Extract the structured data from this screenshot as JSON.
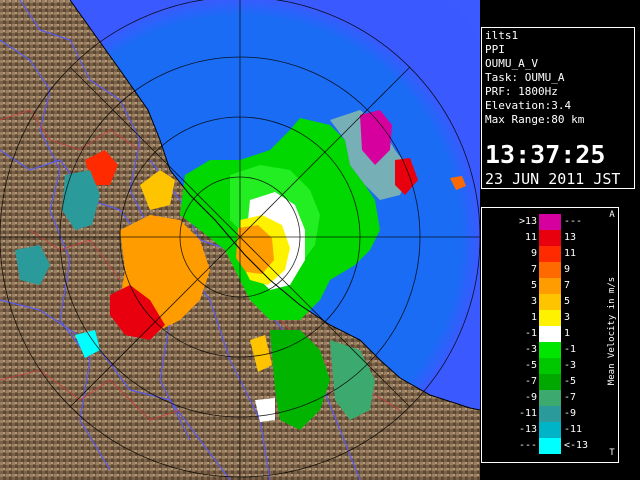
{
  "radar_info": {
    "station": "ilts1",
    "mode": "PPI",
    "product": "OUMU_A_V",
    "task": "Task: OUMU_A",
    "prf": "PRF: 1800Hz",
    "elevation": "Elevation:3.4",
    "max_range": "Max Range:80 km",
    "time": "13:37:25",
    "date": "23 JUN 2011 JST"
  },
  "legend": {
    "title": "Mean Velocity in m/s",
    "top_letter": "A",
    "bottom_letter": "T",
    "bins": [
      {
        "lo": ">13",
        "hi": "---",
        "color": "#d6009e"
      },
      {
        "lo": "11",
        "hi": "13",
        "color": "#e8000e"
      },
      {
        "lo": "9",
        "hi": "11",
        "color": "#ff2a00"
      },
      {
        "lo": "7",
        "hi": "9",
        "color": "#ff6a00"
      },
      {
        "lo": "5",
        "hi": "7",
        "color": "#ff9c00"
      },
      {
        "lo": "3",
        "hi": "5",
        "color": "#ffc400"
      },
      {
        "lo": "1",
        "hi": "3",
        "color": "#fff200"
      },
      {
        "lo": "-1",
        "hi": "1",
        "color": "#ffffff"
      },
      {
        "lo": "-3",
        "hi": "-1",
        "color": "#00e600"
      },
      {
        "lo": "-5",
        "hi": "-3",
        "color": "#00c800"
      },
      {
        "lo": "-7",
        "hi": "-5",
        "color": "#00a800"
      },
      {
        "lo": "-9",
        "hi": "-7",
        "color": "#3caa6e"
      },
      {
        "lo": "-11",
        "hi": "-9",
        "color": "#2a9a9a"
      },
      {
        "lo": "-13",
        "hi": "-11",
        "color": "#00b4c8"
      },
      {
        "lo": "---",
        "hi": "<-13",
        "color": "#00ffff"
      }
    ]
  },
  "colors": {
    "sea": "#0a78f0",
    "sea_edge": "#3c5aff",
    "land": "#8a7050",
    "river": "#5a5af0",
    "range_ring": "#000000"
  }
}
